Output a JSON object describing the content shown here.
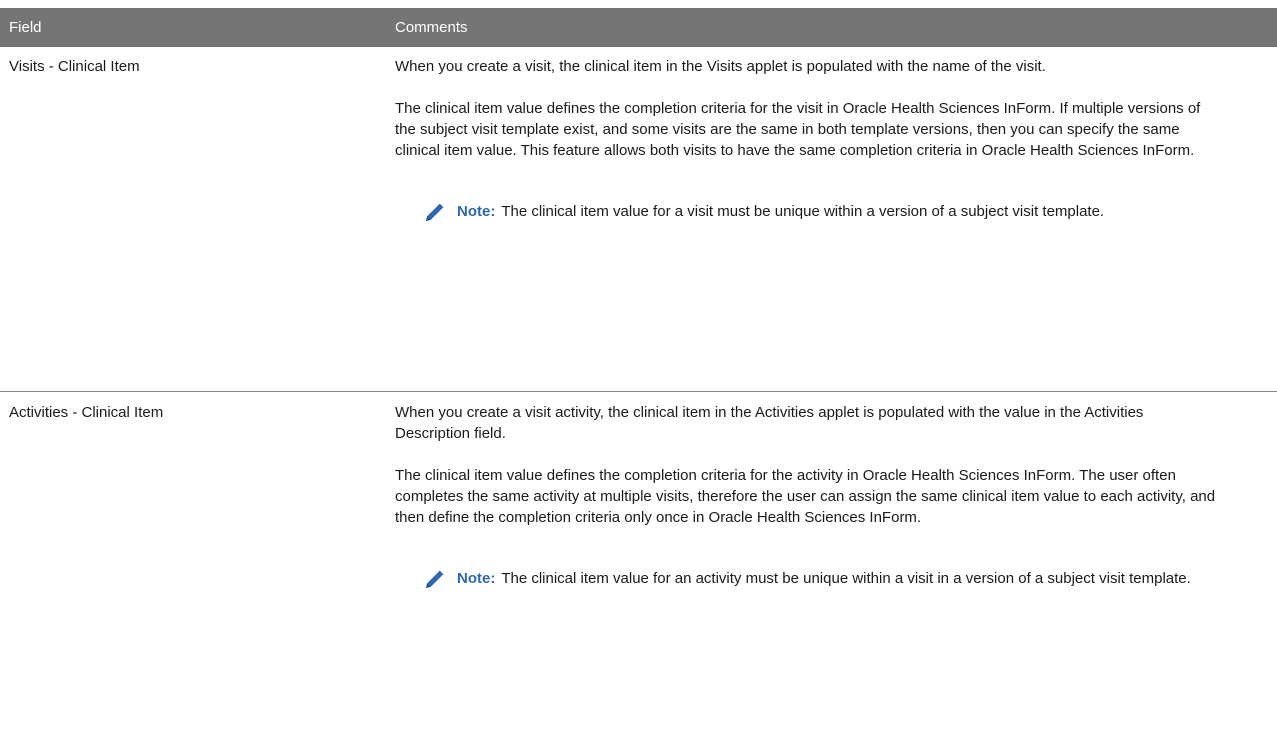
{
  "table": {
    "headers": {
      "field": "Field",
      "comments": "Comments"
    },
    "rows": [
      {
        "field": "Visits - Clinical Item",
        "paragraphs": [
          "When you create a visit, the clinical item in the Visits applet is populated with the name of the visit.",
          "The clinical item value defines the completion criteria for the visit in Oracle Health Sciences InForm. If multiple versions of the subject visit template exist, and some visits are the same in both template versions, then you can specify the same clinical item value. This feature allows both visits to have the same completion criteria in Oracle Health Sciences InForm."
        ],
        "note": {
          "label": "Note:",
          "text": "The clinical item value for a visit must be unique within a version of a subject visit template."
        }
      },
      {
        "field": "Activities - Clinical Item",
        "paragraphs": [
          "When you create a visit activity, the clinical item in the Activities applet is populated with the value in the Activities Description field.",
          "The clinical item value defines the completion criteria for the activity in Oracle Health Sciences InForm. The user often completes the same activity at multiple visits, therefore the user can assign the same clinical item value to each activity, and then define the completion criteria only once in Oracle Health Sciences InForm."
        ],
        "note": {
          "label": "Note:",
          "text": "The clinical item value for an activity must be unique within a visit in a version of a subject visit template."
        }
      }
    ]
  },
  "colors": {
    "header_bg": "#757575",
    "header_text": "#ffffff",
    "note_label": "#2e68b0",
    "icon": "#2e68b0"
  },
  "icons": {
    "note": "pencil-icon"
  }
}
